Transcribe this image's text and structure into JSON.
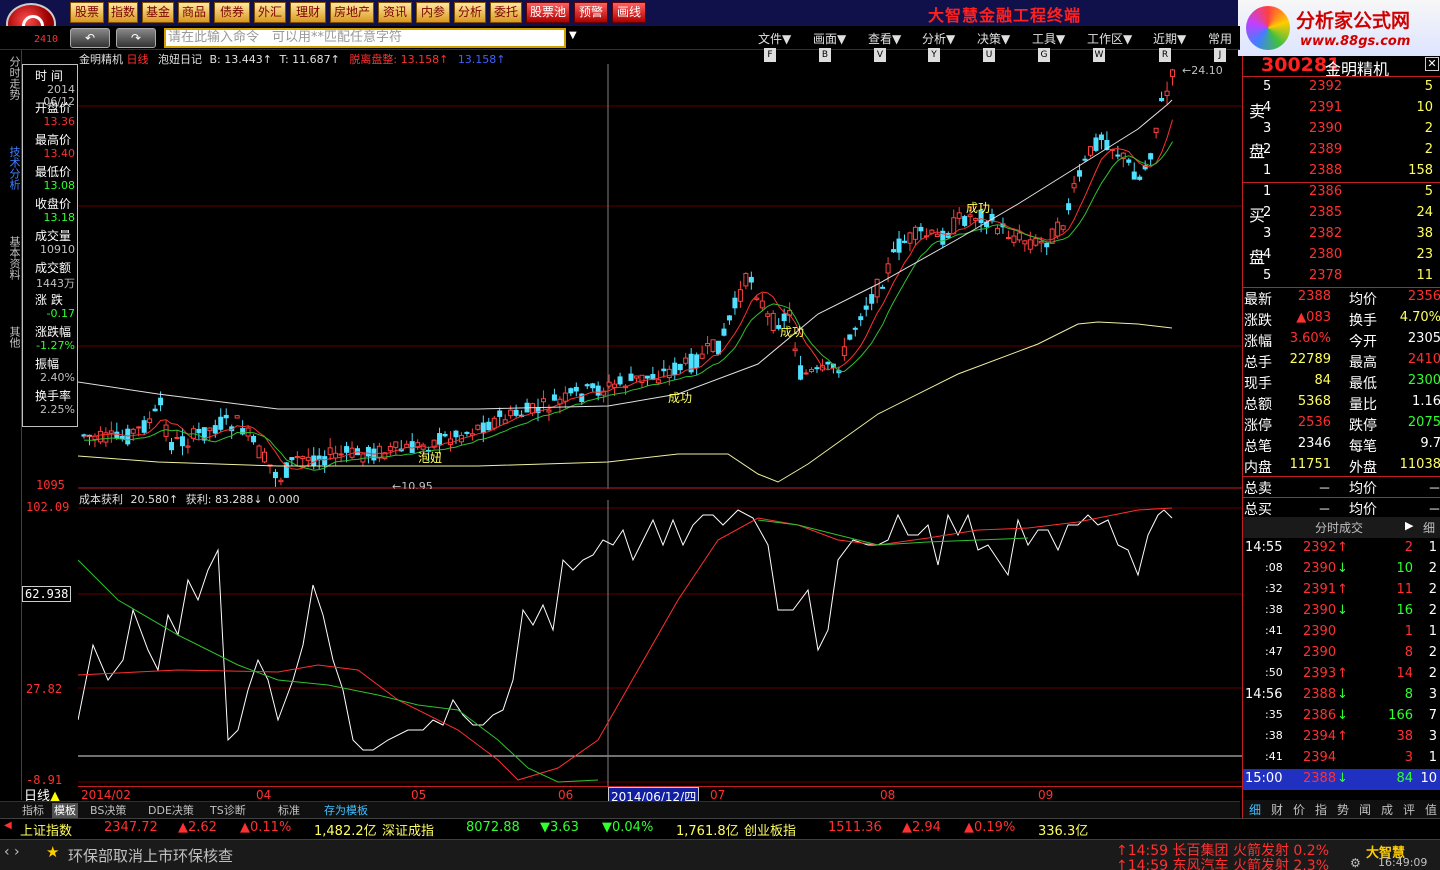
{
  "top_menu": [
    "股票",
    "指数",
    "基金",
    "商品",
    "债券",
    "外汇",
    "理财",
    "房地产",
    "资讯",
    "内参",
    "分析",
    "委托",
    "股票池",
    "预警",
    "画线"
  ],
  "app_title": "大智慧金融工程终端",
  "brand": {
    "name": "分析家公式网",
    "url": "www.88gs.com"
  },
  "nav": {
    "back": "↶",
    "forward": "↷"
  },
  "command_placeholder": "请在此输入命令　可以用**匹配任意字符",
  "menus": [
    {
      "label": "文件▼",
      "key": "F"
    },
    {
      "label": "画面▼",
      "key": "B"
    },
    {
      "label": "查看▼",
      "key": "V"
    },
    {
      "label": "分析▼",
      "key": "Y"
    },
    {
      "label": "决策▼",
      "key": "U"
    },
    {
      "label": "工具▼",
      "key": "G"
    },
    {
      "label": "工作区▼",
      "key": "W"
    },
    {
      "label": "近期▼",
      "key": "R"
    },
    {
      "label": "常用",
      "key": "J"
    }
  ],
  "left_tabs": [
    "分时走势",
    "技术分析",
    "基本资料",
    "其他"
  ],
  "chart_header": {
    "name": "金明精机",
    "period": "日线",
    "indicator": "泡妞日记",
    "b": "B: 13.443↑",
    "t": "T: 11.687↑",
    "exit": "脱离盘整: 13.158↑",
    "extra": "13.158↑"
  },
  "info_panel": [
    {
      "label": "时 间",
      "value": "2014",
      "value2": "06/12",
      "color": "#c0c0c0"
    },
    {
      "label": "开盘价",
      "value": "13.36",
      "color": "#ff3030"
    },
    {
      "label": "最高价",
      "value": "13.40",
      "color": "#ff3030"
    },
    {
      "label": "最低价",
      "value": "13.08",
      "color": "#30ff30"
    },
    {
      "label": "收盘价",
      "value": "13.18",
      "color": "#30ff30"
    },
    {
      "label": "成交量",
      "value": "10910",
      "color": "#c0c0c0"
    },
    {
      "label": "成交额",
      "value": "1443万",
      "color": "#c0c0c0"
    },
    {
      "label": "涨 跌",
      "value": "-0.17",
      "color": "#30ff30"
    },
    {
      "label": "涨跌幅",
      "value": "-1.27%",
      "color": "#30ff30"
    },
    {
      "label": "振幅",
      "value": "2.40%",
      "color": "#c0c0c0"
    },
    {
      "label": "换手率",
      "value": "2.25%",
      "color": "#c0c0c0"
    }
  ],
  "main_axis": {
    "top": "24.10",
    "bottom": "10.95",
    "left_label": "1095",
    "top_left": "2410"
  },
  "chart_annotations": [
    "成功",
    "成功",
    "成功",
    "泡妞"
  ],
  "ind_header": {
    "name": "成本获利",
    "v1": "20.580↑",
    "label2": "获利:",
    "v2": "83.288↓",
    "v3": "0.000"
  },
  "ind_axis": [
    "102.09",
    "62.938",
    "27.82",
    "-8.91"
  ],
  "time_axis": [
    "2014/02",
    "04",
    "05",
    "06",
    "2014/06/12/四",
    "07",
    "08",
    "09"
  ],
  "cursor_date": "2014/06/12/四",
  "period_label": "日线",
  "bottom_tabs": [
    "指标",
    "模板",
    "BS决策",
    "DDE决策",
    "TS诊断",
    "标准",
    "存为模板"
  ],
  "ticker": [
    {
      "name": "上证指数",
      "price": "2347.72",
      "chg": "▲2.62",
      "pct": "▲0.11%",
      "amt": "1,482.2亿"
    },
    {
      "name": "深证成指",
      "price": "8072.88",
      "chg": "▼3.63",
      "pct": "▼0.04%",
      "amt": "1,761.8亿"
    },
    {
      "name": "创业板指",
      "price": "1511.36",
      "chg": "▲2.94",
      "pct": "▲0.19%",
      "amt": "336.3亿"
    }
  ],
  "news": "环保部取消上市环保核查",
  "alerts": [
    "14:59 长百集团 火箭发射 0.2%",
    "14:59 东风汽车 火箭发射 2.3%"
  ],
  "clock": "16:49:09",
  "stock": {
    "code": "300281",
    "name": "金明精机"
  },
  "sell_book": [
    {
      "n": "5",
      "p": "2392",
      "v": "5"
    },
    {
      "n": "4",
      "p": "2391",
      "v": "10"
    },
    {
      "n": "3",
      "p": "2390",
      "v": "2"
    },
    {
      "n": "2",
      "p": "2389",
      "v": "2"
    },
    {
      "n": "1",
      "p": "2388",
      "v": "158"
    }
  ],
  "buy_book": [
    {
      "n": "1",
      "p": "2386",
      "v": "5"
    },
    {
      "n": "2",
      "p": "2385",
      "v": "24"
    },
    {
      "n": "3",
      "p": "2382",
      "v": "38"
    },
    {
      "n": "4",
      "p": "2380",
      "v": "23"
    },
    {
      "n": "5",
      "p": "2378",
      "v": "11"
    }
  ],
  "sell_label": [
    "卖",
    "盘"
  ],
  "buy_label": [
    "买",
    "盘"
  ],
  "quote": [
    [
      "最新",
      "2388",
      "均价",
      "2356"
    ],
    [
      "涨跌",
      "▲083",
      "换手",
      "4.70%"
    ],
    [
      "涨幅",
      "3.60%",
      "今开",
      "2305"
    ],
    [
      "总手",
      "22789",
      "最高",
      "2410"
    ],
    [
      "现手",
      "84",
      "最低",
      "2300"
    ],
    [
      "总额",
      "5368",
      "量比",
      "1.16"
    ],
    [
      "涨停",
      "2536",
      "跌停",
      "2075"
    ],
    [
      "总笔",
      "2346",
      "每笔",
      "9.7"
    ],
    [
      "内盘",
      "11751",
      "外盘",
      "11038"
    ],
    [
      "总卖",
      "－",
      "均价",
      "－"
    ],
    [
      "总买",
      "－",
      "均价",
      "－"
    ]
  ],
  "ticks_title": "分时成交",
  "ticks_more": "细",
  "ticks": [
    {
      "t": "14:55",
      "p": "2392",
      "d": "↑",
      "v": "2",
      "n": "1"
    },
    {
      "t": ":08",
      "p": "2390",
      "d": "↓",
      "v": "10",
      "n": "2"
    },
    {
      "t": ":32",
      "p": "2391",
      "d": "↑",
      "v": "11",
      "n": "2"
    },
    {
      "t": ":38",
      "p": "2390",
      "d": "↓",
      "v": "16",
      "n": "2"
    },
    {
      "t": ":41",
      "p": "2390",
      "d": "",
      "v": "1",
      "n": "1"
    },
    {
      "t": ":47",
      "p": "2390",
      "d": "",
      "v": "8",
      "n": "2"
    },
    {
      "t": ":50",
      "p": "2393",
      "d": "↑",
      "v": "14",
      "n": "2"
    },
    {
      "t": "14:56",
      "p": "2388",
      "d": "↓",
      "v": "8",
      "n": "3"
    },
    {
      "t": ":35",
      "p": "2386",
      "d": "↓",
      "v": "166",
      "n": "7"
    },
    {
      "t": ":38",
      "p": "2394",
      "d": "↑",
      "v": "38",
      "n": "3"
    },
    {
      "t": ":41",
      "p": "2394",
      "d": "",
      "v": "3",
      "n": "1"
    },
    {
      "t": "15:00",
      "p": "2388",
      "d": "↓",
      "v": "84",
      "n": "10"
    }
  ],
  "right_tabs": [
    "细",
    "财",
    "价",
    "指",
    "势",
    "闻",
    "成",
    "评",
    "值"
  ]
}
